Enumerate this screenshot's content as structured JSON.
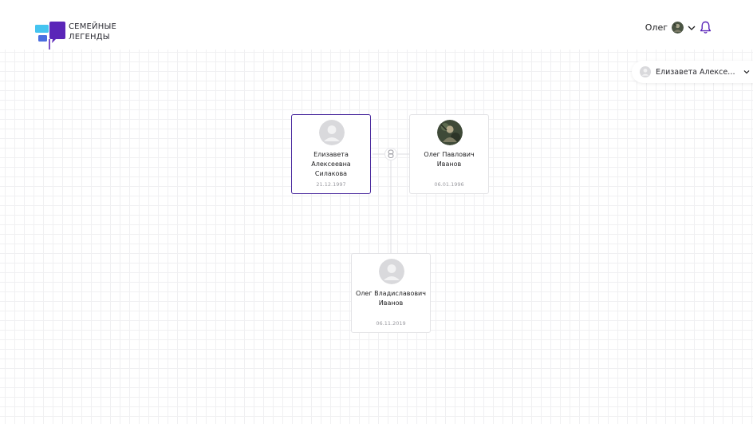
{
  "logo": {
    "line1": "СЕМЕЙНЫЕ",
    "line2": "ЛЕГЕНДЫ",
    "colors": {
      "purple": "#5a25b8",
      "cyan": "#45c4f0",
      "blue": "#4a6ee0"
    }
  },
  "header": {
    "user_name": "Олег",
    "icons": [
      "avatar",
      "chevron-down-icon",
      "bell-icon"
    ],
    "bell_color": "#5a25b8"
  },
  "person_selector": {
    "label": "Елизавета Алексеевна Силакова",
    "icon": "avatar-placeholder-icon"
  },
  "tree": {
    "cards": [
      {
        "id": "elizaveta",
        "name": "Елизавета Алексеевна Силакова",
        "date": "21.12.1997",
        "selected": true,
        "photo": "placeholder"
      },
      {
        "id": "oleg-pavlovich",
        "name": "Олег Павлович Иванов",
        "date": "06.01.1996",
        "selected": false,
        "photo": "photo"
      },
      {
        "id": "oleg-vladislavovich",
        "name": "Олег Владиславович Иванов",
        "date": "06.11.2019",
        "selected": false,
        "photo": "placeholder"
      }
    ],
    "marriage_icon": "rings-icon",
    "selected_color": "#4a2a9e"
  }
}
